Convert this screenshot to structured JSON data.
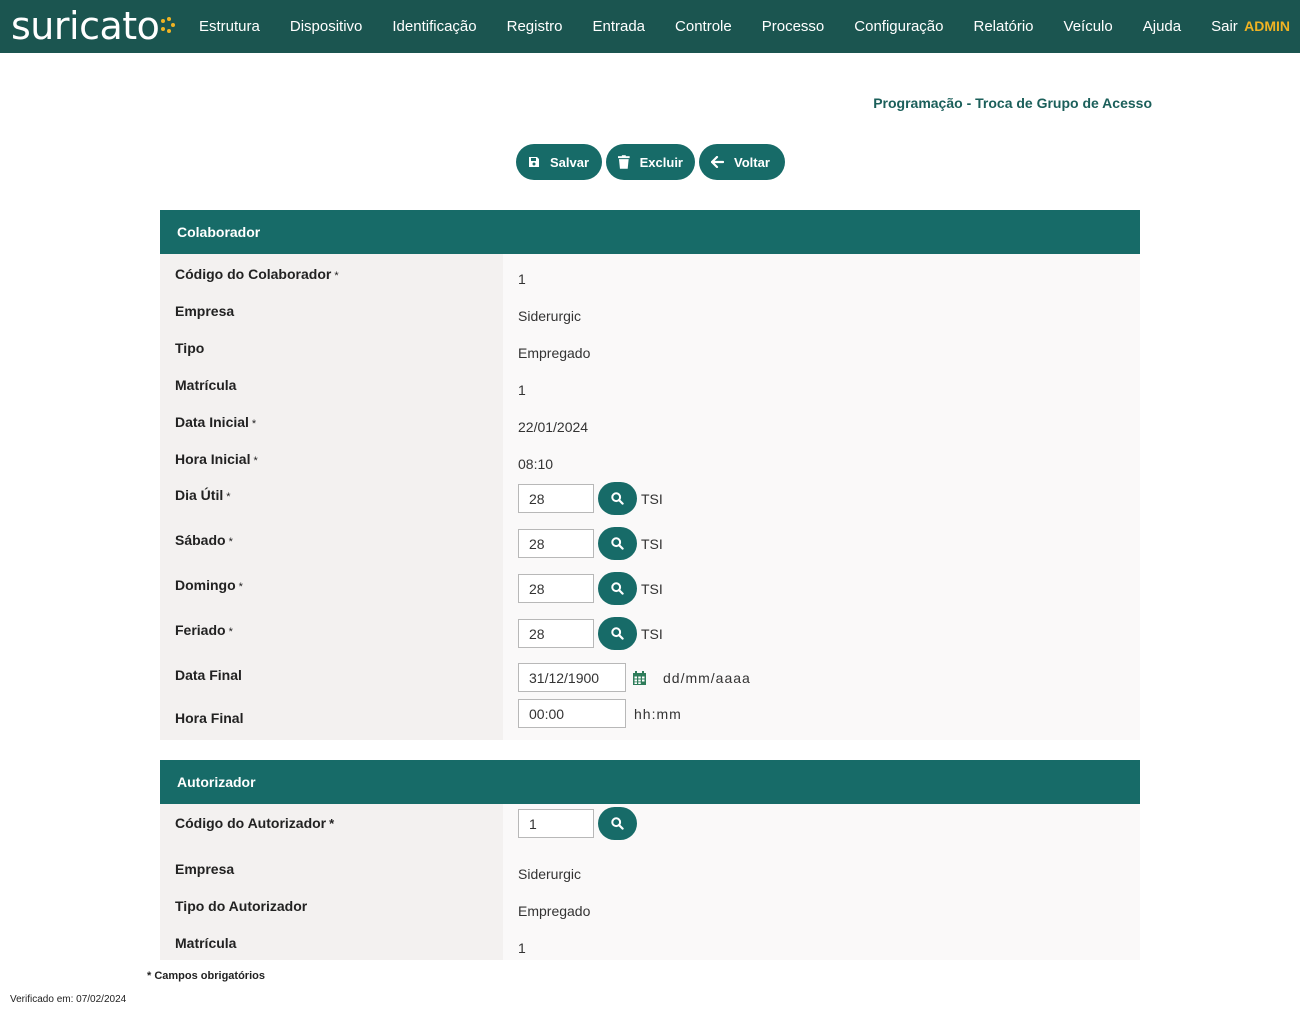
{
  "app": {
    "logo_text": "suricato",
    "user": "ADMIN",
    "nav": [
      "Estrutura",
      "Dispositivo",
      "Identificação",
      "Registro",
      "Entrada",
      "Controle",
      "Processo",
      "Configuração",
      "Relatório",
      "Veículo",
      "Ajuda",
      "Sair"
    ]
  },
  "page": {
    "title": "Programação - Troca de Grupo de Acesso"
  },
  "actions": {
    "save_label": "Salvar",
    "delete_label": "Excluir",
    "back_label": "Voltar"
  },
  "colaborador": {
    "header": "Colaborador",
    "codigo": {
      "label": "Código do Colaborador",
      "required": "*",
      "value": "1"
    },
    "empresa": {
      "label": "Empresa",
      "value": "Siderurgic"
    },
    "tipo": {
      "label": "Tipo",
      "value": "Empregado"
    },
    "matricula": {
      "label": "Matrícula",
      "value": "1"
    },
    "data_inicial": {
      "label": "Data Inicial",
      "required": "*",
      "value": "22/01/2024"
    },
    "hora_inicial": {
      "label": "Hora Inicial",
      "required": "*",
      "value": "08:10"
    },
    "dia_util": {
      "label": "Dia Útil",
      "required": "*",
      "value": "28",
      "suffix": "TSI"
    },
    "sabado": {
      "label": "Sábado",
      "required": "*",
      "value": "28",
      "suffix": "TSI"
    },
    "domingo": {
      "label": "Domingo",
      "required": "*",
      "value": "28",
      "suffix": "TSI"
    },
    "feriado": {
      "label": "Feriado",
      "required": "*",
      "value": "28",
      "suffix": "TSI"
    },
    "data_final": {
      "label": "Data Final",
      "value": "31/12/1900",
      "hint": "dd/mm/aaaa"
    },
    "hora_final": {
      "label": "Hora Final",
      "value": "00:00",
      "hint": "hh:mm"
    }
  },
  "autorizador": {
    "header": "Autorizador",
    "codigo": {
      "label": "Código do Autorizador",
      "required": "*",
      "value": "1"
    },
    "empresa": {
      "label": "Empresa",
      "value": "Siderurgic"
    },
    "tipo": {
      "label": "Tipo do Autorizador",
      "value": "Empregado"
    },
    "matricula": {
      "label": "Matrícula",
      "value": "1"
    }
  },
  "footer": {
    "required_note": "* Campos obrigatórios",
    "verified": "Verificado em: 07/02/2024"
  },
  "colors": {
    "nav_bg": "#1b5550",
    "accent": "#176b68",
    "admin": "#f0b323",
    "title": "#1b5f5a"
  },
  "icons": {
    "save": "floppy-disk-icon",
    "delete": "trash-icon",
    "back": "arrow-left-icon",
    "search": "search-icon",
    "calendar": "calendar-icon"
  }
}
